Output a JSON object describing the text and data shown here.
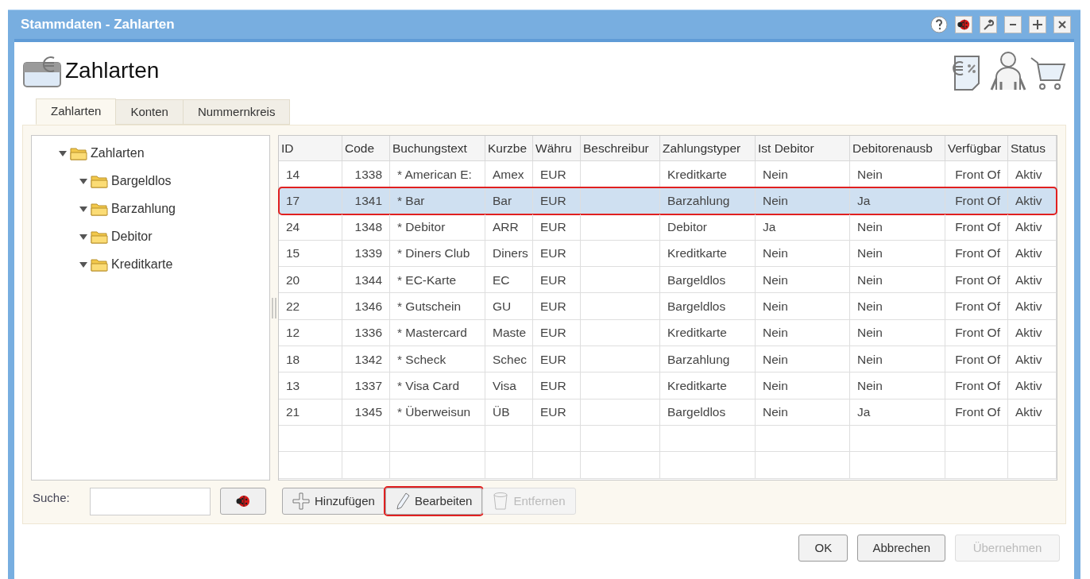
{
  "window": {
    "title": "Stammdaten - Zahlarten"
  },
  "header": {
    "title": "Zahlarten"
  },
  "tabs": [
    {
      "label": "Zahlarten",
      "selected": true
    },
    {
      "label": "Konten",
      "selected": false
    },
    {
      "label": "Nummernkreis",
      "selected": false
    }
  ],
  "tree": [
    {
      "label": "Zahlarten",
      "expanded": true,
      "children": [
        {
          "label": "Bargeldlos",
          "expanded": true
        },
        {
          "label": "Barzahlung",
          "expanded": true
        },
        {
          "label": "Debitor",
          "expanded": true
        },
        {
          "label": "Kreditkarte",
          "expanded": true
        }
      ]
    }
  ],
  "search": {
    "label": "Suche:"
  },
  "table": {
    "columns": [
      "ID",
      "Code",
      "Buchungstext",
      "Kurzbe",
      "Währu",
      "Beschreibur",
      "Zahlungstyper",
      "Ist Debitor",
      "Debitorenausb",
      "Verfügbar",
      "Status"
    ],
    "rows": [
      {
        "selected": false,
        "cells": [
          "14",
          "1338",
          "* American E:",
          "Amex",
          "EUR",
          "",
          "Kreditkarte",
          "Nein",
          "Nein",
          "Front Of",
          "Aktiv"
        ]
      },
      {
        "selected": true,
        "cells": [
          "17",
          "1341",
          "* Bar",
          "Bar",
          "EUR",
          "",
          "Barzahlung",
          "Nein",
          "Ja",
          "Front Of",
          "Aktiv"
        ]
      },
      {
        "selected": false,
        "cells": [
          "24",
          "1348",
          "* Debitor",
          "ARR",
          "EUR",
          "",
          "Debitor",
          "Ja",
          "Nein",
          "Front Of",
          "Aktiv"
        ]
      },
      {
        "selected": false,
        "cells": [
          "15",
          "1339",
          "* Diners Club",
          "Diners",
          "EUR",
          "",
          "Kreditkarte",
          "Nein",
          "Nein",
          "Front Of",
          "Aktiv"
        ]
      },
      {
        "selected": false,
        "cells": [
          "20",
          "1344",
          "* EC-Karte",
          "EC",
          "EUR",
          "",
          "Bargeldlos",
          "Nein",
          "Nein",
          "Front Of",
          "Aktiv"
        ]
      },
      {
        "selected": false,
        "cells": [
          "22",
          "1346",
          "* Gutschein",
          "GU",
          "EUR",
          "",
          "Bargeldlos",
          "Nein",
          "Nein",
          "Front Of",
          "Aktiv"
        ]
      },
      {
        "selected": false,
        "cells": [
          "12",
          "1336",
          "* Mastercard",
          "Maste",
          "EUR",
          "",
          "Kreditkarte",
          "Nein",
          "Nein",
          "Front Of",
          "Aktiv"
        ]
      },
      {
        "selected": false,
        "cells": [
          "18",
          "1342",
          "* Scheck",
          "Schec",
          "EUR",
          "",
          "Barzahlung",
          "Nein",
          "Nein",
          "Front Of",
          "Aktiv"
        ]
      },
      {
        "selected": false,
        "cells": [
          "13",
          "1337",
          "* Visa Card",
          "Visa",
          "EUR",
          "",
          "Kreditkarte",
          "Nein",
          "Nein",
          "Front Of",
          "Aktiv"
        ]
      },
      {
        "selected": false,
        "cells": [
          "21",
          "1345",
          "* Überweisun",
          "ÜB",
          "EUR",
          "",
          "Bargeldlos",
          "Nein",
          "Ja",
          "Front Of",
          "Aktiv"
        ]
      }
    ]
  },
  "table_buttons": [
    {
      "kind": "add",
      "label": "Hinzufügen",
      "disabled": false,
      "highlighted": false
    },
    {
      "kind": "edit",
      "label": "Bearbeiten",
      "disabled": false,
      "highlighted": true
    },
    {
      "kind": "remove",
      "label": "Entfernen",
      "disabled": true,
      "highlighted": false
    }
  ],
  "dialog_buttons": [
    {
      "label": "OK",
      "disabled": false
    },
    {
      "label": "Abbrechen",
      "disabled": false
    },
    {
      "label": "Übernehmen",
      "disabled": true
    }
  ]
}
